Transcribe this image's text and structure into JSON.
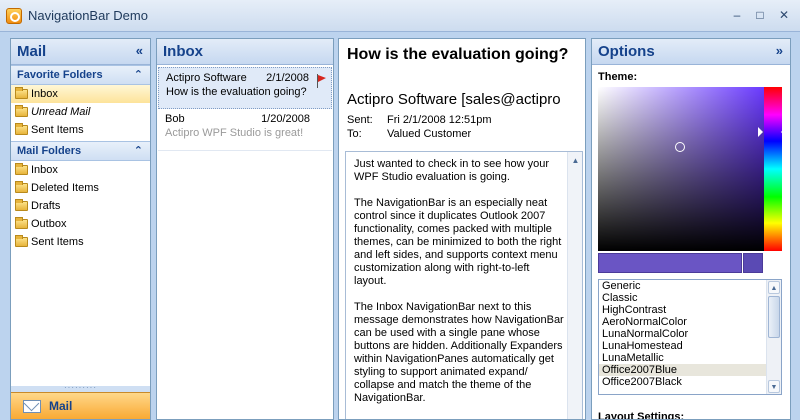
{
  "window": {
    "title": "NavigationBar Demo",
    "minimize": "–",
    "maximize": "□",
    "close": "✕",
    "app_icon": "navigationbar-app-icon"
  },
  "mail_pane": {
    "title": "Mail",
    "collapse_glyph": "«",
    "favorite_header": "Favorite Folders",
    "mail_folders_header": "Mail Folders",
    "group_chevron": "⌃",
    "favorites": [
      {
        "label": "Inbox"
      },
      {
        "label": "Unread Mail"
      },
      {
        "label": "Sent Items"
      }
    ],
    "folders": [
      {
        "label": "Inbox"
      },
      {
        "label": "Deleted Items"
      },
      {
        "label": "Drafts"
      },
      {
        "label": "Outbox"
      },
      {
        "label": "Sent Items"
      }
    ],
    "splitter_grip": "·········",
    "nav_button": "Mail"
  },
  "inbox": {
    "title": "Inbox",
    "messages": [
      {
        "from": "Actipro Software",
        "date": "2/1/2008",
        "subject": "How is the evaluation going?"
      },
      {
        "from": "Bob",
        "date": "1/20/2008",
        "subject": "Actipro WPF Studio is great!"
      }
    ]
  },
  "reading": {
    "title": "How is the evaluation going?",
    "sender": "Actipro Software [sales@actipro",
    "sent_label": "Sent:",
    "sent_value": "Fri 2/1/2008 12:51pm",
    "to_label": "To:",
    "to_value": "Valued Customer",
    "scroll_up": "▲",
    "body": [
      "Just wanted to check in to see how your WPF Studio evaluation is going.",
      "The NavigationBar is an especially neat control since it duplicates Outlook 2007 functionality, comes packed with multiple themes, can be minimized to both the right and left sides, and supports context menu customization along with right-to-left layout.",
      "The Inbox NavigationBar next to this message demonstrates how NavigationBar can be used with a single pane whose buttons are hidden. Additionally Expanders within NavigationPanes automatically get styling to support animated expand/ collapse and match the theme of the NavigationBar."
    ]
  },
  "options": {
    "title": "Options",
    "expand_glyph": "»",
    "theme_label": "Theme:",
    "layout_label": "Layout Settings:",
    "colors": {
      "new": "#6a55c4",
      "old": "#5a4ab4"
    },
    "list_up": "▲",
    "list_down": "▼",
    "themes": [
      "Generic",
      "Classic",
      "HighContrast",
      "AeroNormalColor",
      "LunaNormalColor",
      "LunaHomestead",
      "LunaMetallic",
      "Office2007Blue",
      "Office2007Black"
    ],
    "selected_theme": "Office2007Blue"
  }
}
